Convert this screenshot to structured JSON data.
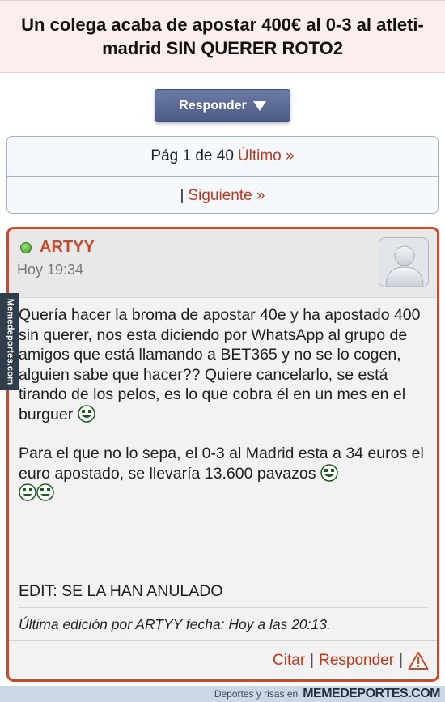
{
  "thread": {
    "title": "Un colega acaba de apostar 400€ al 0-3 al atleti-madrid SIN QUERER ROTO2"
  },
  "toolbar": {
    "reply_label": "Responder"
  },
  "pagination": {
    "page_info": "Pág 1 de 40",
    "last_label": "Último »",
    "separator": "|",
    "next_label": "Siguiente »"
  },
  "post": {
    "author": "ARTYY",
    "time": "Hoy 19:34",
    "body": {
      "paragraph_1": "Quería hacer la broma de apostar 40e y ha apostado 400 sin querer, nos esta diciendo por WhatsApp al grupo de amigos que está llamando a BET365 y no se lo cogen, alguien sabe que hacer?? Quiere cancelarlo, se está tirando de los pelos, es lo que cobra él en un mes en el burguer",
      "paragraph_2": "Para el que no lo sepa, el 0-3 al Madrid esta a 34 euros el euro apostado, se llevaría 13.600 pavazos",
      "edit_text": "EDIT: SE LA HAN ANULADO"
    },
    "edit_note": "Última edición por ARTYY fecha: Hoy a las 20:13.",
    "actions": {
      "quote_label": "Citar",
      "separator": "|",
      "reply_label": "Responder",
      "separator_2": "|"
    },
    "online_color": "#4caf2a",
    "accent_color": "#c84b2d"
  },
  "watermark": {
    "side_text": "Memedeportes.com",
    "bottom_small": "Deportes y risas en",
    "bottom_brand": "MEMEDEPORTES.COM"
  },
  "icons": [
    "online-status-icon",
    "default-avatar-icon",
    "laughing-smiley-icon",
    "warning-icon",
    "dropdown-triangle-icon"
  ]
}
